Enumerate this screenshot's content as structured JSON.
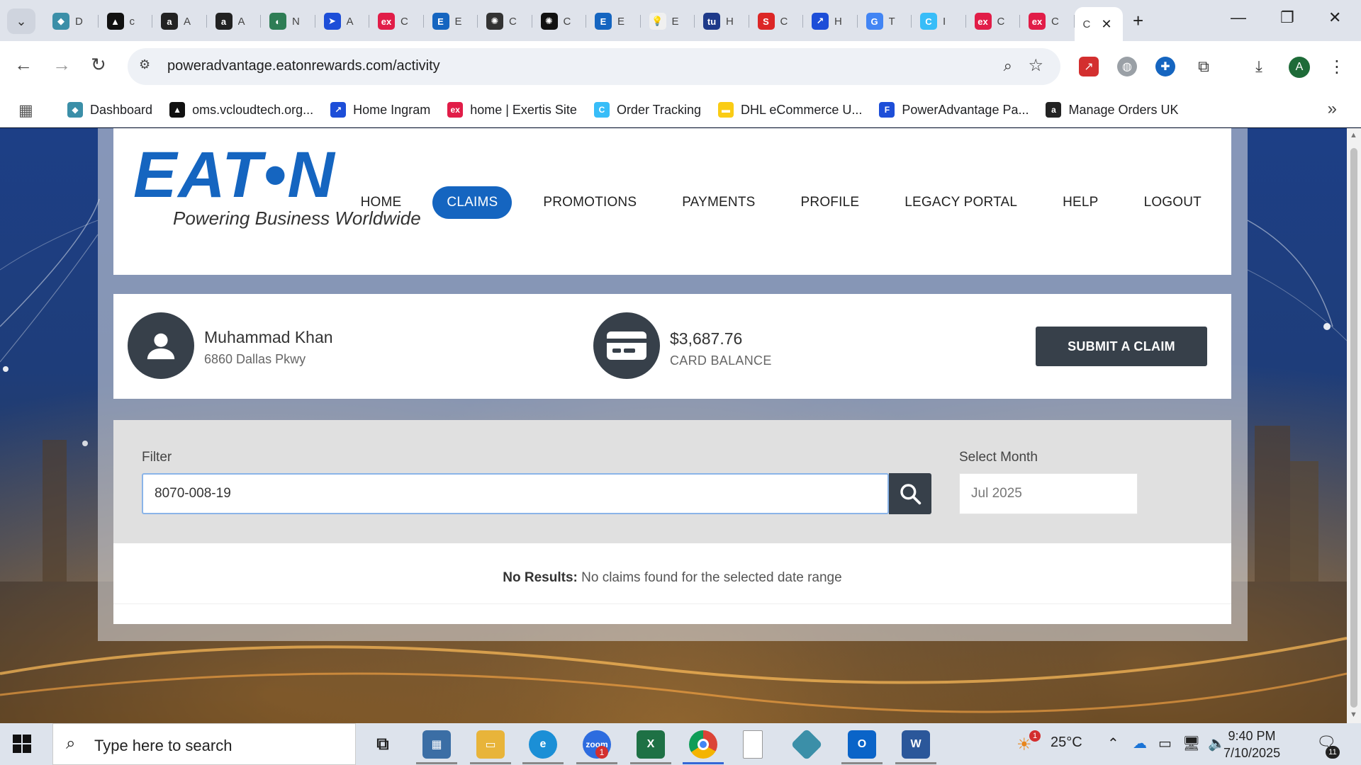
{
  "browser": {
    "tabs": [
      {
        "icon": "globe-diamond-icon",
        "letter": "◆",
        "title": "D",
        "color": "#3b8fa8"
      },
      {
        "icon": "triangle-logo-icon",
        "letter": "▲",
        "title": "c",
        "color": "#111111"
      },
      {
        "icon": "amazon-icon",
        "letter": "a",
        "title": "A",
        "color": "#222222"
      },
      {
        "icon": "amazon-icon",
        "letter": "a",
        "title": "A",
        "color": "#222222"
      },
      {
        "icon": "shield-icon",
        "letter": "◐",
        "title": "N",
        "color": "#2e7d55"
      },
      {
        "icon": "arrow-icon",
        "letter": "➤",
        "title": "A",
        "color": "#1d4ed8"
      },
      {
        "icon": "ex-icon",
        "letter": "ex",
        "title": "C",
        "color": "#e11d48"
      },
      {
        "icon": "e-logo-icon",
        "letter": "E",
        "title": "E",
        "color": "#1565c0"
      },
      {
        "icon": "openai-icon",
        "letter": "✺",
        "title": "C",
        "color": "#333333"
      },
      {
        "icon": "openai-icon",
        "letter": "✺",
        "title": "C",
        "color": "#111111"
      },
      {
        "icon": "e-logo-icon",
        "letter": "E",
        "title": "E",
        "color": "#1565c0"
      },
      {
        "icon": "bulb-icon",
        "letter": "💡",
        "title": "E",
        "color": "#f0f0f0"
      },
      {
        "icon": "badge-icon",
        "letter": "tu",
        "title": "H",
        "color": "#1e3a8a"
      },
      {
        "icon": "stack-icon",
        "letter": "S",
        "title": "C",
        "color": "#dc2626"
      },
      {
        "icon": "ingram-icon",
        "letter": "↗",
        "title": "H",
        "color": "#1d4ed8"
      },
      {
        "icon": "google-icon",
        "letter": "G",
        "title": "T",
        "color": "#4285f4"
      },
      {
        "icon": "c-logo-icon",
        "letter": "C",
        "title": "I",
        "color": "#38bdf8"
      },
      {
        "icon": "ex-icon",
        "letter": "ex",
        "title": "C",
        "color": "#e11d48"
      },
      {
        "icon": "ex-icon",
        "letter": "ex",
        "title": "C",
        "color": "#e11d48"
      }
    ],
    "active_tab_title": "C",
    "url": "poweradvantage.eatonrewards.com/activity",
    "profile_letter": "A",
    "bookmarks": [
      {
        "label": "Dashboard",
        "icon": "globe-diamond-icon",
        "color": "#3b8fa8",
        "glyph": "◆"
      },
      {
        "label": "oms.vcloudtech.org...",
        "icon": "triangle-logo-icon",
        "color": "#111111",
        "glyph": "▲"
      },
      {
        "label": "Home Ingram",
        "icon": "ingram-icon",
        "color": "#1d4ed8",
        "glyph": "↗"
      },
      {
        "label": "home | Exertis Site",
        "icon": "ex-icon",
        "color": "#e11d48",
        "glyph": "ex"
      },
      {
        "label": "Order Tracking",
        "icon": "c-logo-icon",
        "color": "#38bdf8",
        "glyph": "C"
      },
      {
        "label": "DHL eCommerce U...",
        "icon": "dhl-icon",
        "color": "#facc15",
        "glyph": "▬"
      },
      {
        "label": "PowerAdvantage Pa...",
        "icon": "document-icon",
        "color": "#1d4ed8",
        "glyph": "F"
      },
      {
        "label": "Manage Orders UK",
        "icon": "amazon-icon",
        "color": "#222222",
        "glyph": "a"
      }
    ]
  },
  "site": {
    "brand": {
      "wordmark": "EAT•N",
      "tagline": "Powering Business Worldwide"
    },
    "nav": [
      {
        "label": "HOME",
        "active": false
      },
      {
        "label": "CLAIMS",
        "active": true
      },
      {
        "label": "PROMOTIONS",
        "active": false
      },
      {
        "label": "PAYMENTS",
        "active": false
      },
      {
        "label": "PROFILE",
        "active": false
      },
      {
        "label": "LEGACY PORTAL",
        "active": false
      },
      {
        "label": "HELP",
        "active": false
      },
      {
        "label": "LOGOUT",
        "active": false
      }
    ],
    "user": {
      "name": "Muhammad Khan",
      "address": "6860 Dallas Pkwy"
    },
    "balance": {
      "value": "$3,687.76",
      "label": "CARD BALANCE"
    },
    "submit_label": "SUBMIT A CLAIM",
    "filter": {
      "label": "Filter",
      "value": "8070-008-19"
    },
    "month": {
      "label": "Select Month",
      "value": "Jul 2025"
    },
    "results": {
      "heading": "No Results:",
      "message": "No claims found for the selected date range"
    }
  },
  "taskbar": {
    "search_placeholder": "Type here to search",
    "weather": "25°C",
    "time": "9:40 PM",
    "date": "7/10/2025",
    "notification_count": "11",
    "zoom_badge": "1",
    "weather_badge": "1"
  },
  "colors": {
    "brand_blue": "#1565c0",
    "dark_slate": "#37404a"
  }
}
